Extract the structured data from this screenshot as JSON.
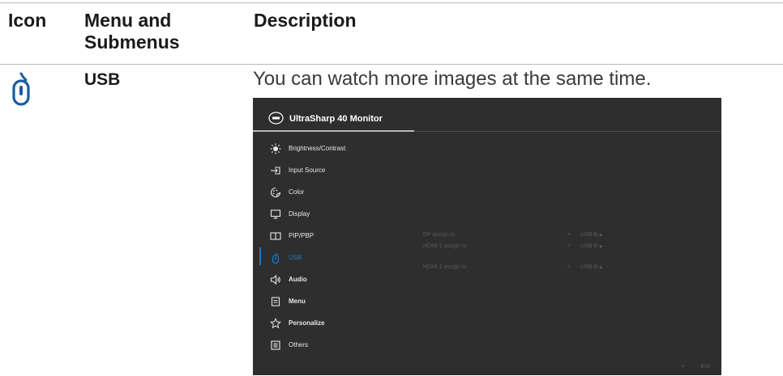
{
  "table": {
    "headers": {
      "icon": "Icon",
      "menu": "Menu and Submenus",
      "description": "Description"
    },
    "row": {
      "menu": "USB",
      "description": "You can watch more images at the same time."
    }
  },
  "osd": {
    "title": "UltraSharp 40 Monitor",
    "menu_items": [
      {
        "label": "Brightness/Contrast",
        "icon": "brightness-icon"
      },
      {
        "label": "Input Source",
        "icon": "input-source-icon"
      },
      {
        "label": "Color",
        "icon": "color-icon"
      },
      {
        "label": "Display",
        "icon": "display-icon"
      },
      {
        "label": "PIP/PBP",
        "icon": "pip-pbp-icon"
      },
      {
        "label": "USB",
        "icon": "usb-icon",
        "active": true
      },
      {
        "label": "Audio",
        "icon": "audio-icon"
      },
      {
        "label": "Menu",
        "icon": "menu-icon"
      },
      {
        "label": "Personalize",
        "icon": "star-icon"
      },
      {
        "label": "Others",
        "icon": "others-icon"
      }
    ],
    "options": [
      {
        "name": "DP assign to",
        "chevron": ">",
        "value": "USB-B"
      },
      {
        "name": "HDMI 1 assign to",
        "chevron": ">",
        "value": "USB-B"
      },
      {
        "name": "HDMI 2 assign to",
        "chevron": ">",
        "value": "USB-B"
      }
    ],
    "exit_chevron": "<",
    "exit_label": "Exit",
    "colors": {
      "background": "#2e2e2e",
      "accent": "#1e78c8",
      "doc_icon": "#1a5c9e"
    }
  }
}
